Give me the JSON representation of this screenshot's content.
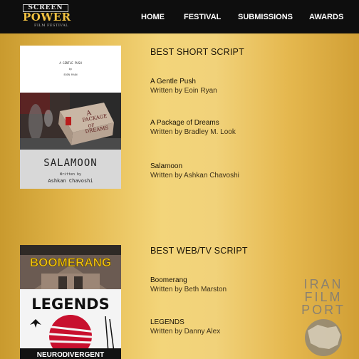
{
  "logo": {
    "line1": "SCREEN",
    "line2": "POWER",
    "line3": "FILM FESTIVAL"
  },
  "nav": {
    "items": [
      {
        "label": "HOME"
      },
      {
        "label": "FESTIVAL"
      },
      {
        "label": "SUBMISSIONS"
      },
      {
        "label": "AWARDS"
      }
    ]
  },
  "sections": [
    {
      "title": "BEST SHORT SCRIPT",
      "entries": [
        {
          "title": "A Gentle Push",
          "author": "Written by Eoin Ryan"
        },
        {
          "title": "A Package of Dreams",
          "author": "Written by Bradley M. Look"
        },
        {
          "title": "Salamoon",
          "author": "Written by Ashkan Chavoshi"
        }
      ],
      "poster": {
        "small_line1": "A GENTLE PUSH",
        "small_line2": "by",
        "small_line3": "EOIN RYAN",
        "box_text": [
          "A",
          "PACKAGE",
          "OF",
          "DREAMS"
        ],
        "title": "SALAMOON",
        "written_by": "Written by",
        "author": "Ashkan Chavoshi"
      }
    },
    {
      "title": "BEST WEB/TV SCRIPT",
      "entries": [
        {
          "title": "Boomerang",
          "author": "Written by Beth Marston"
        },
        {
          "title": "LEGENDS",
          "author": "Written by Danny Alex"
        }
      ],
      "poster": {
        "top": "BOOMERANG",
        "middle": "LEGENDS",
        "bottom": "NEURODIVERGENT"
      }
    }
  ],
  "watermark": {
    "line1": "IRAN",
    "line2": "FILM",
    "line3": "PORT"
  },
  "colors": {
    "nav_bg": "#0e0e0e",
    "logo_gold": "#f0c040",
    "boomerang_yellow": "#f2c511",
    "legends_red": "#c8102e"
  }
}
